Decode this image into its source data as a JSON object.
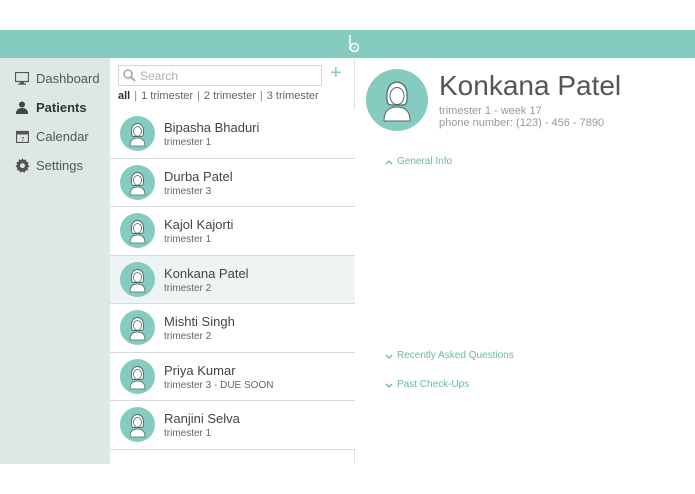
{
  "nav": [
    {
      "label": "Dashboard",
      "icon": "monitor-icon",
      "active": false
    },
    {
      "label": "Patients",
      "icon": "person-icon",
      "active": true
    },
    {
      "label": "Calendar",
      "icon": "calendar-icon",
      "active": false
    },
    {
      "label": "Settings",
      "icon": "gear-icon",
      "active": false
    }
  ],
  "search": {
    "placeholder": "Search"
  },
  "add_label": "+",
  "filters": [
    {
      "label": "all",
      "active": true
    },
    {
      "label": "1 trimester",
      "active": false
    },
    {
      "label": "2 trimester",
      "active": false
    },
    {
      "label": "3 trimester",
      "active": false
    }
  ],
  "patients": [
    {
      "name": "Bipasha Bhaduri",
      "status": "trimester 1"
    },
    {
      "name": "Durba Patel",
      "status": "trimester 3"
    },
    {
      "name": "Kajol Kajorti",
      "status": "trimester 1"
    },
    {
      "name": "Konkana Patel",
      "status": "trimester 2"
    },
    {
      "name": "Mishti Singh",
      "status": "trimester 2"
    },
    {
      "name": "Priya Kumar",
      "status": "trimester 3 - DUE SOON"
    },
    {
      "name": "Ranjini Selva",
      "status": "trimester 1"
    }
  ],
  "selected_index": 3,
  "detail": {
    "name": "Konkana Patel",
    "line1": "trimester 1 - week 17",
    "line2": "phone number: (123) - 456 - 7890",
    "sections": [
      {
        "label": "General Info",
        "expanded": true
      },
      {
        "label": "Recently Asked Questions",
        "expanded": false
      },
      {
        "label": "Past Check-Ups",
        "expanded": false
      }
    ]
  },
  "colors": {
    "accent": "#86cbbf",
    "sidebar": "#dde7e6",
    "selected_row": "#eef3f3"
  }
}
